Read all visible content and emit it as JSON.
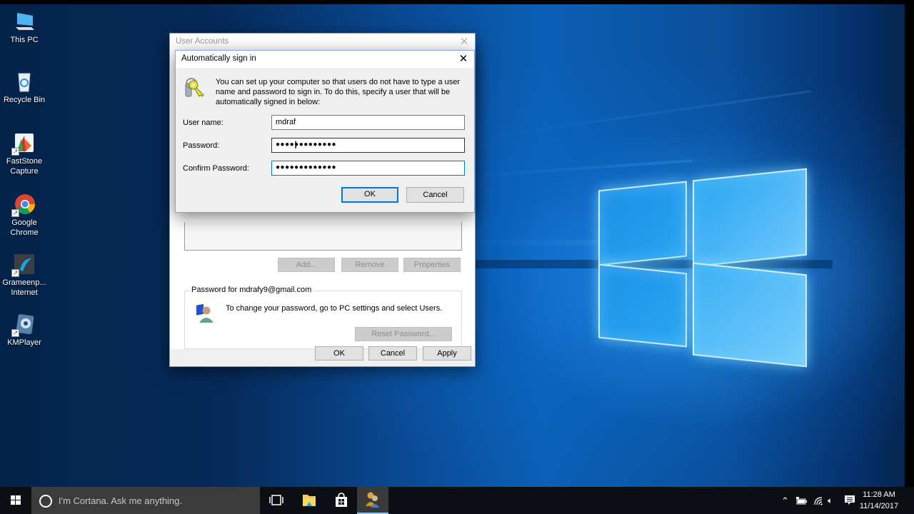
{
  "desktop": {
    "icons": [
      {
        "label": "This PC",
        "icon": "this-pc-icon"
      },
      {
        "label": "Recycle Bin",
        "icon": "recycle-bin-icon"
      },
      {
        "label": "FastStone Capture",
        "icon": "faststone-capture-icon"
      },
      {
        "label": "Google Chrome",
        "icon": "google-chrome-icon"
      },
      {
        "label": "Grameenp... Internet",
        "icon": "grameenphone-internet-icon"
      },
      {
        "label": "KMPlayer",
        "icon": "kmplayer-icon"
      }
    ]
  },
  "user_accounts_window": {
    "title": "User Accounts",
    "buttons": {
      "add": "Add...",
      "remove": "Remove",
      "properties": "Properties"
    },
    "password_group": {
      "legend": "Password for mdrafy9@gmail.com",
      "message": "To change your password, go to PC settings and select Users.",
      "reset_button": "Reset Password..."
    },
    "footer": {
      "ok": "OK",
      "cancel": "Cancel",
      "apply": "Apply"
    }
  },
  "auto_signin_dialog": {
    "title": "Automatically sign in",
    "description": "You can set up your computer so that users do not have to type a user name and password to sign in. To do this, specify a user that will be automatically signed in below:",
    "fields": {
      "username_label": "User name:",
      "username_value": "mdraf",
      "password_label": "Password:",
      "password_value": "●●●●●●●●●●●●●",
      "confirm_label": "Confirm Password:",
      "confirm_value": "●●●●●●●●●●●●●"
    },
    "ok": "OK",
    "cancel": "Cancel"
  },
  "taskbar": {
    "cortana_placeholder": "I'm Cortana. Ask me anything.",
    "apps": [
      "task-view",
      "file-explorer",
      "store",
      "user-accounts"
    ],
    "active_app": "user-accounts",
    "clock": {
      "time": "11:28 AM",
      "date": "11/14/2017"
    }
  },
  "colors": {
    "accent": "#0078d7",
    "taskbar": "#0b0f14",
    "cortana_box": "#3b3b3b"
  }
}
